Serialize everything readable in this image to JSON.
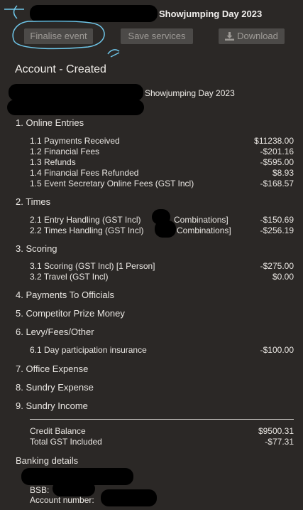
{
  "header": {
    "event_title": "Showjumping Day 2023"
  },
  "toolbar": {
    "finalise_label": "Finalise event",
    "save_label": "Save services",
    "download_label": "Download"
  },
  "account": {
    "title": "Account - Created",
    "event_name": "Showjumping Day 2023"
  },
  "sections": [
    {
      "heading": "1. Online Entries",
      "rows": [
        {
          "label": "1.1 Payments Received",
          "value": "$11238.00"
        },
        {
          "label": "1.2 Financial Fees",
          "value": "-$201.16"
        },
        {
          "label": "1.3 Refunds",
          "value": "-$595.00"
        },
        {
          "label": "1.4 Financial Fees Refunded",
          "value": "$8.93"
        },
        {
          "label": "1.5 Event Secretary Online Fees (GST Incl)",
          "value": "-$168.57"
        }
      ]
    },
    {
      "heading": "2. Times",
      "rows": [
        {
          "label": "2.1 Entry Handling (GST Incl)",
          "label_suffix": "Combinations]",
          "value": "-$150.69"
        },
        {
          "label": "2.2 Times Handling (GST Incl)",
          "label_suffix": "Combinations]",
          "value": "-$256.19"
        }
      ]
    },
    {
      "heading": "3. Scoring",
      "rows": [
        {
          "label": "3.1 Scoring (GST Incl) [1 Person]",
          "value": "-$275.00"
        },
        {
          "label": "3.2 Travel (GST Incl)",
          "value": "$0.00"
        }
      ]
    },
    {
      "heading": "4. Payments To Officials",
      "rows": []
    },
    {
      "heading": "5. Competitor Prize Money",
      "rows": []
    },
    {
      "heading": "6. Levy/Fees/Other",
      "rows": [
        {
          "label": "6.1 Day participation insurance",
          "value": "-$100.00"
        }
      ]
    },
    {
      "heading": "7. Office Expense",
      "rows": []
    },
    {
      "heading": "8. Sundry Expense",
      "rows": []
    },
    {
      "heading": "9. Sundry Income",
      "rows": []
    }
  ],
  "totals": [
    {
      "label": "Credit Balance",
      "value": "$9500.31"
    },
    {
      "label": "Total GST Included",
      "value": "-$77.31"
    }
  ],
  "banking": {
    "title": "Banking details",
    "bsb_label": "BSB:",
    "account_label": "Account number:"
  },
  "colors": {
    "background": "#2b2826",
    "annotation": "#6fc7ea"
  }
}
